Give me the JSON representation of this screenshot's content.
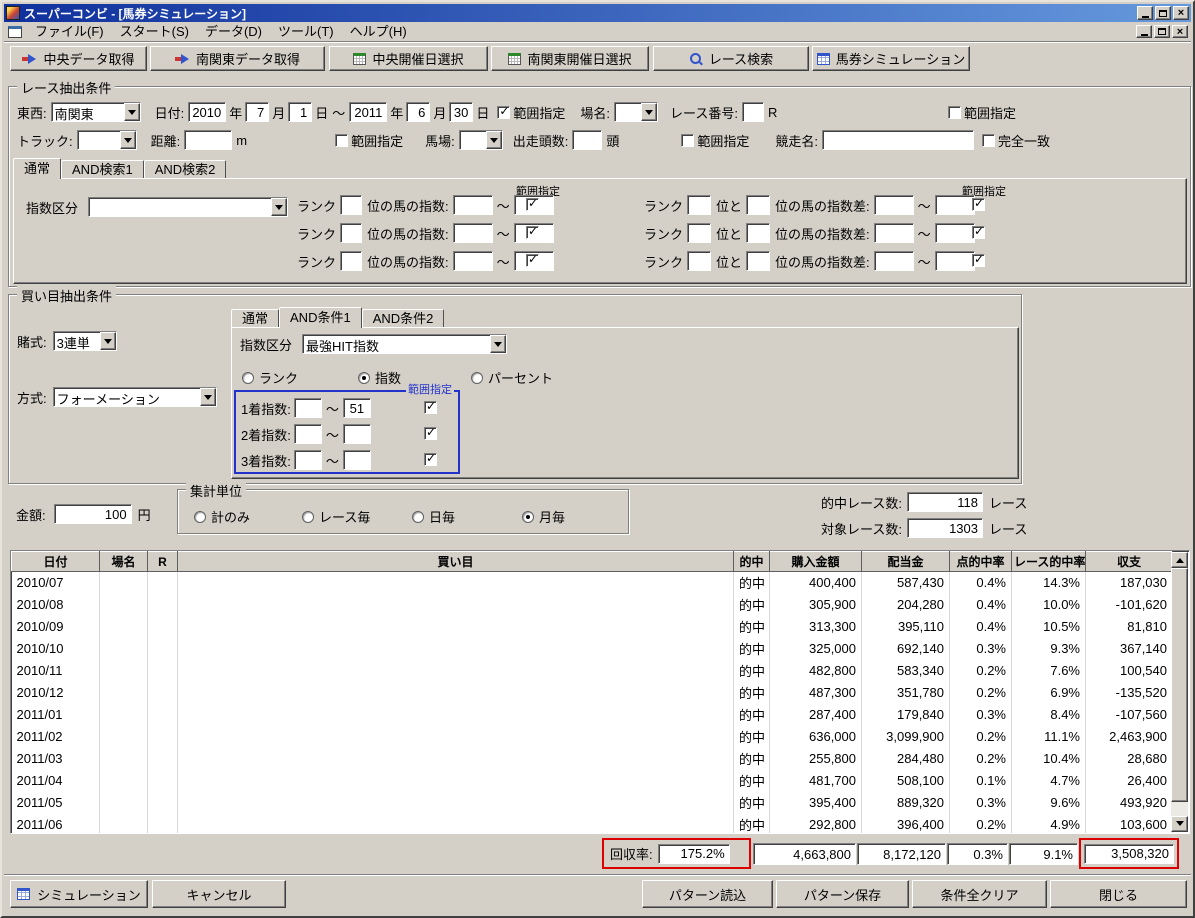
{
  "window": {
    "title": "スーパーコンビ - [馬券シミュレーション]"
  },
  "menubar": {
    "items": [
      "ファイル(F)",
      "スタート(S)",
      "データ(D)",
      "ツール(T)",
      "ヘルプ(H)"
    ]
  },
  "toolbar": {
    "buttons": [
      {
        "label": "中央データ取得",
        "icon": "transfer-arrow-icon"
      },
      {
        "label": "南関東データ取得",
        "icon": "transfer-arrow-icon"
      },
      {
        "label": "中央開催日選択",
        "icon": "calendar-icon"
      },
      {
        "label": "南関東開催日選択",
        "icon": "calendar-icon"
      },
      {
        "label": "レース検索",
        "icon": "search-icon"
      },
      {
        "label": "馬券シミュレーション",
        "icon": "grid-icon"
      }
    ]
  },
  "race": {
    "group_title": "レース抽出条件",
    "east_west_label": "東西:",
    "east_west_value": "南関東",
    "date_label": "日付:",
    "from_year": "2010",
    "from_month": "7",
    "from_day": "1",
    "to_year": "2011",
    "to_month": "6",
    "to_day": "30",
    "year_unit": "年",
    "month_unit": "月",
    "day_unit": "日",
    "tilde": "～",
    "range_label": "範囲指定",
    "date_range_checked": true,
    "place_label": "場名:",
    "race_no_label": "レース番号:",
    "race_no_unit": "R",
    "place_range_checked": false,
    "track_label": "トラック:",
    "distance_label": "距離:",
    "distance_unit": "m",
    "track_range_checked": false,
    "baba_label": "馬場:",
    "heads_label": "出走頭数:",
    "heads_unit": "頭",
    "baba_range_checked": false,
    "race_name_label": "競走名:",
    "exact_label": "完全一致",
    "exact_checked": false,
    "tabs": [
      "通常",
      "AND検索1",
      "AND検索2"
    ],
    "index_label": "指数区分",
    "rank_label": "ランク",
    "rank_suffix": "位の馬の指数:",
    "and_label": "位と",
    "diff_suffix": "位の馬の指数差:",
    "idx_checks": [
      true,
      true,
      true
    ],
    "diff_checks": [
      true,
      true,
      true
    ]
  },
  "bet": {
    "group_title": "買い目抽出条件",
    "bet_type_label": "賭式:",
    "bet_type_value": "3連単",
    "method_label": "方式:",
    "method_value": "フォーメーション",
    "tabs": [
      "通常",
      "AND条件1",
      "AND条件2"
    ],
    "index_label": "指数区分",
    "index_value": "最強HIT指数",
    "options": [
      {
        "label": "ランク",
        "selected": false
      },
      {
        "label": "指数",
        "selected": true
      },
      {
        "label": "パーセント",
        "selected": false
      }
    ],
    "range_label": "範囲指定",
    "tilde": "～",
    "rows": [
      {
        "label": "1着指数:",
        "from": "",
        "to": "51",
        "checked": true
      },
      {
        "label": "2着指数:",
        "from": "",
        "to": "",
        "checked": true
      },
      {
        "label": "3着指数:",
        "from": "",
        "to": "",
        "checked": true
      }
    ]
  },
  "amount": {
    "label": "金額:",
    "value": "100",
    "unit": "円"
  },
  "aggregate": {
    "group_title": "集計単位",
    "options": [
      {
        "label": "計のみ",
        "selected": false
      },
      {
        "label": "レース毎",
        "selected": false
      },
      {
        "label": "日毎",
        "selected": false
      },
      {
        "label": "月毎",
        "selected": true
      }
    ]
  },
  "stats": {
    "hit_label": "的中レース数:",
    "hit_value": "118",
    "target_label": "対象レース数:",
    "target_value": "1303",
    "unit": "レース"
  },
  "table": {
    "columns": [
      "日付",
      "場名",
      "R",
      "買い目",
      "的中",
      "購入金額",
      "配当金",
      "点的中率",
      "レース的中率",
      "収支"
    ],
    "rows": [
      [
        "2010/07",
        "",
        "",
        "",
        "的中",
        "400,400",
        "587,430",
        "0.4%",
        "14.3%",
        "187,030"
      ],
      [
        "2010/08",
        "",
        "",
        "",
        "的中",
        "305,900",
        "204,280",
        "0.4%",
        "10.0%",
        "-101,620"
      ],
      [
        "2010/09",
        "",
        "",
        "",
        "的中",
        "313,300",
        "395,110",
        "0.4%",
        "10.5%",
        "81,810"
      ],
      [
        "2010/10",
        "",
        "",
        "",
        "的中",
        "325,000",
        "692,140",
        "0.3%",
        "9.3%",
        "367,140"
      ],
      [
        "2010/11",
        "",
        "",
        "",
        "的中",
        "482,800",
        "583,340",
        "0.2%",
        "7.6%",
        "100,540"
      ],
      [
        "2010/12",
        "",
        "",
        "",
        "的中",
        "487,300",
        "351,780",
        "0.2%",
        "6.9%",
        "-135,520"
      ],
      [
        "2011/01",
        "",
        "",
        "",
        "的中",
        "287,400",
        "179,840",
        "0.3%",
        "8.4%",
        "-107,560"
      ],
      [
        "2011/02",
        "",
        "",
        "",
        "的中",
        "636,000",
        "3,099,900",
        "0.2%",
        "11.1%",
        "2,463,900"
      ],
      [
        "2011/03",
        "",
        "",
        "",
        "的中",
        "255,800",
        "284,480",
        "0.2%",
        "10.4%",
        "28,680"
      ],
      [
        "2011/04",
        "",
        "",
        "",
        "的中",
        "481,700",
        "508,100",
        "0.1%",
        "4.7%",
        "26,400"
      ],
      [
        "2011/05",
        "",
        "",
        "",
        "的中",
        "395,400",
        "889,320",
        "0.3%",
        "9.6%",
        "493,920"
      ],
      [
        "2011/06",
        "",
        "",
        "",
        "的中",
        "292,800",
        "396,400",
        "0.2%",
        "4.9%",
        "103,600"
      ]
    ]
  },
  "summary": {
    "recovery_label": "回収率:",
    "recovery_value": "175.2%",
    "purchase_total": "4,663,800",
    "payout_total": "8,172,120",
    "point_rate_total": "0.3%",
    "race_rate_total": "9.1%",
    "balance_total": "3,508,320"
  },
  "footer": {
    "buttons": [
      "シミュレーション",
      "キャンセル",
      "パターン読込",
      "パターン保存",
      "条件全クリア",
      "閉じる"
    ]
  },
  "colors": {
    "highlight_red": "#dd0000",
    "highlight_blue": "#2233cc",
    "titlebar_left": "#10309c",
    "titlebar_right": "#6699dd"
  }
}
